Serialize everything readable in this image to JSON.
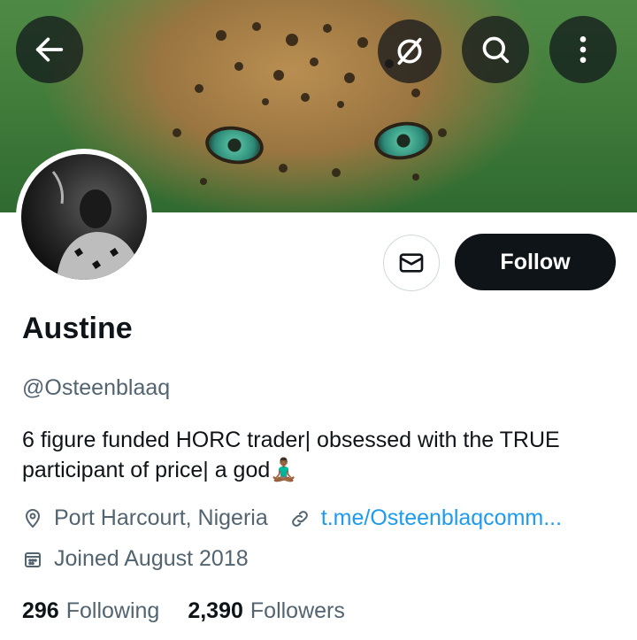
{
  "header": {
    "back_icon": "arrow-left-icon",
    "grok_icon": "grok-icon",
    "search_icon": "search-icon",
    "more_icon": "more-vertical-icon"
  },
  "profile": {
    "name": "Austine",
    "handle": "@Osteenblaaq",
    "bio": "6 figure funded HORC trader| obsessed with the TRUE participant of price| a god🧘🏾‍♂️",
    "location": "Port Harcourt, Nigeria",
    "website": "t.me/Osteenblaqcomm...",
    "joined": "Joined August 2018"
  },
  "actions": {
    "message_icon": "envelope-icon",
    "follow_label": "Follow"
  },
  "stats": {
    "following_count": "296",
    "following_label": "Following",
    "followers_count": "2,390",
    "followers_label": "Followers"
  },
  "colors": {
    "text_primary": "#0f1419",
    "text_secondary": "#536471",
    "link": "#1d9bf0",
    "follow_bg": "#0f1419"
  }
}
